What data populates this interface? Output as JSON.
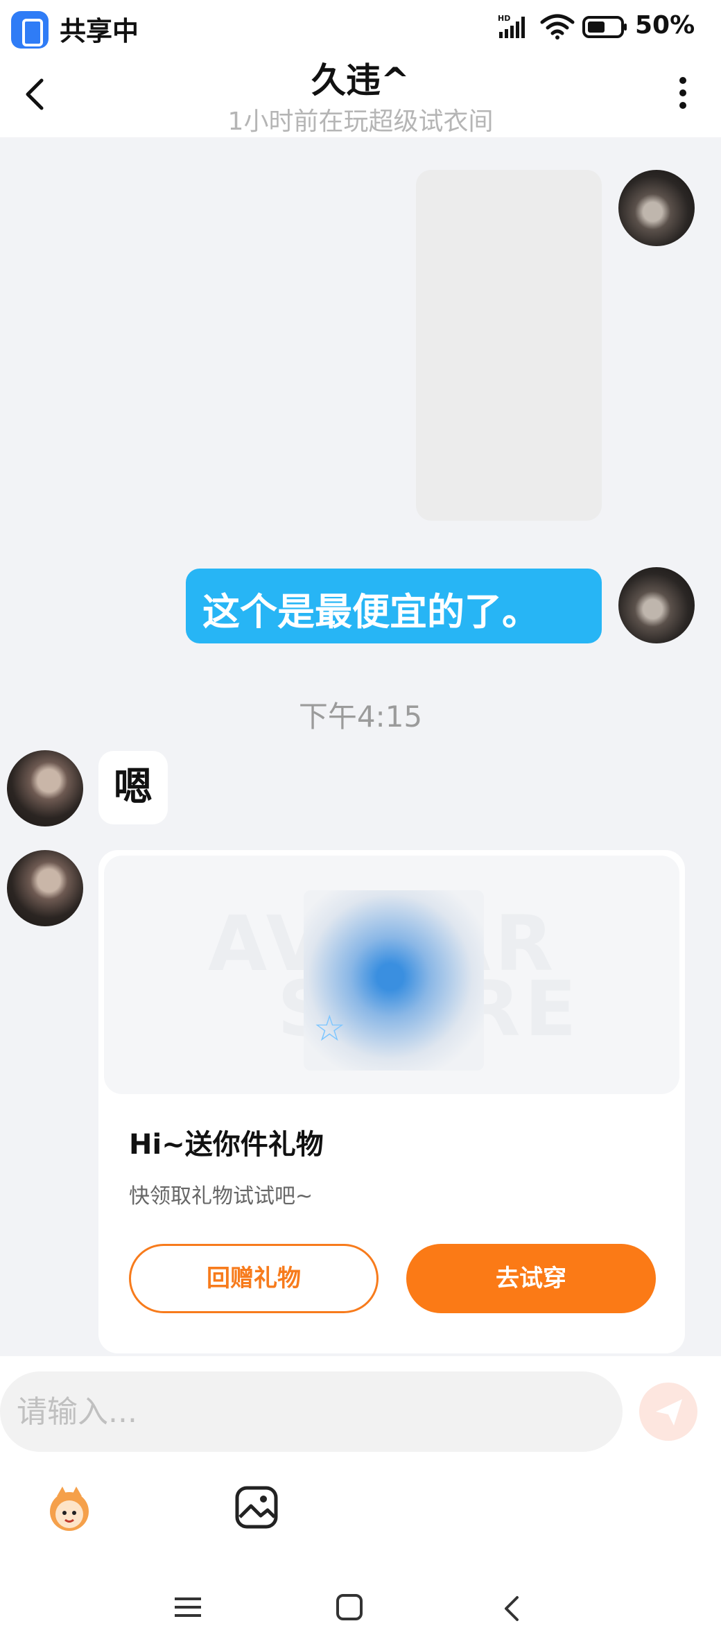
{
  "status_bar": {
    "share_label": "共享中",
    "network": "HD",
    "battery": "50%"
  },
  "header": {
    "title": "久违^",
    "subtitle": "1小时前在玩超级试衣间"
  },
  "messages": {
    "outgoing_text": "这个是最便宜的了。",
    "timestamp": "下午4:15",
    "incoming_text": "嗯"
  },
  "gift_card": {
    "banner_watermark_line1": "AVATAR",
    "banner_watermark_line2": "STORE",
    "title": "Hi~送你件礼物",
    "subtitle": "快领取礼物试试吧~",
    "return_button": "回赠礼物",
    "try_button": "去试穿"
  },
  "composer": {
    "placeholder": "请输入..."
  },
  "colors": {
    "outgoing_bubble": "#27b5f5",
    "accent_orange": "#fb7a16",
    "send_disabled": "#fde6df"
  },
  "icons": [
    "share-screen-icon",
    "signal-icon",
    "wifi-icon",
    "battery-icon",
    "back-icon",
    "more-icon",
    "send-icon",
    "emoji-mascot-icon",
    "image-icon",
    "nav-menu-icon",
    "nav-home-icon",
    "nav-back-icon",
    "star-icon"
  ]
}
